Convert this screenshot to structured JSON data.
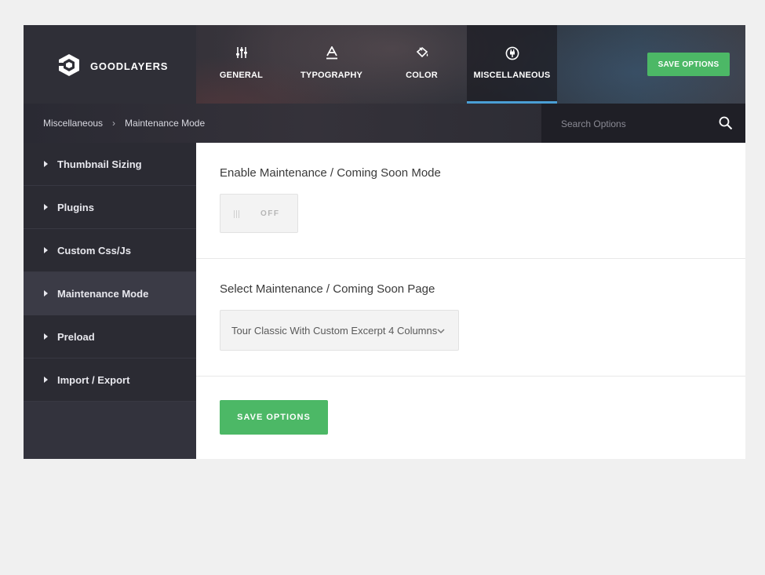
{
  "brand": {
    "name": "GOODLAYERS",
    "logo_icon": "goodlayers-logo-icon"
  },
  "nav": {
    "tabs": [
      {
        "label": "GENERAL",
        "icon": "sliders-icon"
      },
      {
        "label": "TYPOGRAPHY",
        "icon": "text-a-icon"
      },
      {
        "label": "COLOR",
        "icon": "paint-bucket-icon"
      },
      {
        "label": "MISCELLANEOUS",
        "icon": "plug-icon",
        "active": true
      }
    ]
  },
  "header": {
    "save_label": "SAVE OPTIONS"
  },
  "breadcrumb": {
    "parent": "Miscellaneous",
    "separator": "›",
    "current": "Maintenance Mode"
  },
  "search": {
    "placeholder": "Search Options",
    "icon": "search-icon"
  },
  "sidebar": {
    "items": [
      {
        "label": "Thumbnail Sizing"
      },
      {
        "label": "Plugins"
      },
      {
        "label": "Custom Css/Js"
      },
      {
        "label": "Maintenance Mode",
        "active": true
      },
      {
        "label": "Preload"
      },
      {
        "label": "Import / Export"
      }
    ]
  },
  "main": {
    "maintenance_toggle": {
      "title": "Enable Maintenance / Coming Soon Mode",
      "state": "OFF"
    },
    "page_select": {
      "title": "Select Maintenance / Coming Soon Page",
      "value": "Tour Classic With Custom Excerpt 4 Columns"
    },
    "save_label": "SAVE OPTIONS"
  },
  "colors": {
    "accent_green": "#4cb866",
    "active_tab_underline": "#4a9fd5",
    "sidebar_bg": "#2b2b33",
    "sidebar_active_bg": "#3b3b46"
  }
}
